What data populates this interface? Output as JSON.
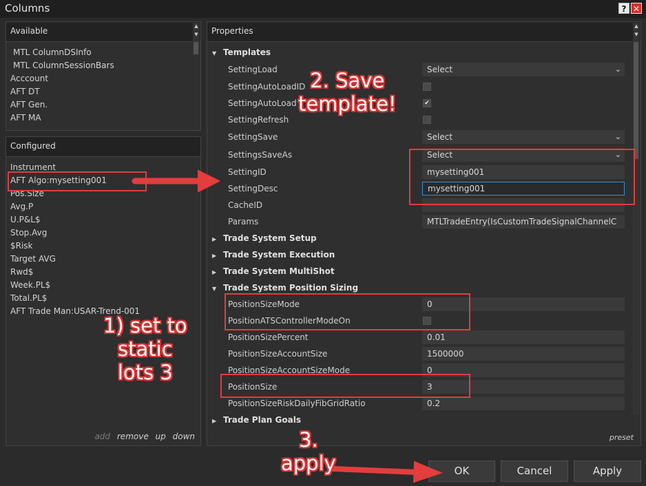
{
  "window": {
    "title": "Columns",
    "help_glyph": "?",
    "close_glyph": "✕"
  },
  "available": {
    "header": "Available",
    "items": [
      "MTL ColumnDSInfo",
      "MTL ColumnSessionBars",
      "Acccount",
      "AFT DT",
      "AFT Gen.",
      "AFT MA"
    ]
  },
  "configured": {
    "header": "Configured",
    "items": [
      "Instrument",
      "AFT Algo:mysetting001",
      "Pos.Size",
      "Avg.P",
      "U.P&L$",
      "Stop.Avg",
      "$Risk",
      "Target AVG",
      "Rwd$",
      "Week.PL$",
      "Total.PL$",
      "AFT Trade Man:USAR-Trend-001"
    ],
    "actions": {
      "add": "add",
      "remove": "remove",
      "up": "up",
      "down": "down"
    }
  },
  "properties": {
    "header": "Properties",
    "categories": {
      "templates": "Templates",
      "setup": "Trade System Setup",
      "execution": "Trade System Execution",
      "multishot": "Trade System MultiShot",
      "sizing": "Trade System Position Sizing",
      "goals": "Trade Plan Goals"
    },
    "templates": {
      "setting_load": {
        "label": "SettingLoad",
        "value": "Select"
      },
      "setting_autoload_id": {
        "label": "SettingAutoLoadID",
        "checked": false
      },
      "setting_autoload": {
        "label": "SettingAutoLoad",
        "checked": true
      },
      "setting_refresh": {
        "label": "SettingRefresh",
        "checked": false
      },
      "setting_save": {
        "label": "SettingSave",
        "value": "Select"
      },
      "settings_save_as": {
        "label": "SettingsSaveAs",
        "value": "Select"
      },
      "setting_id": {
        "label": "SettingID",
        "value": "mysetting001"
      },
      "setting_desc": {
        "label": "SettingDesc",
        "value": "mysetting001"
      },
      "cache_id": {
        "label": "CacheID",
        "value": ""
      },
      "params": {
        "label": "Params",
        "value": "MTLTradeEntry(IsCustomTradeSignalChannelC"
      }
    },
    "sizing": {
      "mode": {
        "label": "PositionSizeMode",
        "value": "0"
      },
      "ats": {
        "label": "PositionATSControllerModeOn",
        "checked": false
      },
      "percent": {
        "label": "PositionSizePercent",
        "value": "0.01"
      },
      "account_size": {
        "label": "PositionSizeAccountSize",
        "value": "1500000"
      },
      "account_size_mode": {
        "label": "PositionSizeAccountSizeMode",
        "value": "0"
      },
      "size": {
        "label": "PositionSize",
        "value": "3"
      },
      "risk_ratio": {
        "label": "PositionSizeRiskDailyFibGridRatio",
        "value": "0.2"
      }
    },
    "preset": "preset"
  },
  "buttons": {
    "ok": "OK",
    "cancel": "Cancel",
    "apply": "Apply"
  },
  "annotations": {
    "step1": [
      "1) set to",
      "static",
      "lots 3"
    ],
    "step2": [
      "2. Save",
      "template!"
    ],
    "step3": [
      "3.",
      "apply"
    ],
    "color": "#e33d3d"
  }
}
